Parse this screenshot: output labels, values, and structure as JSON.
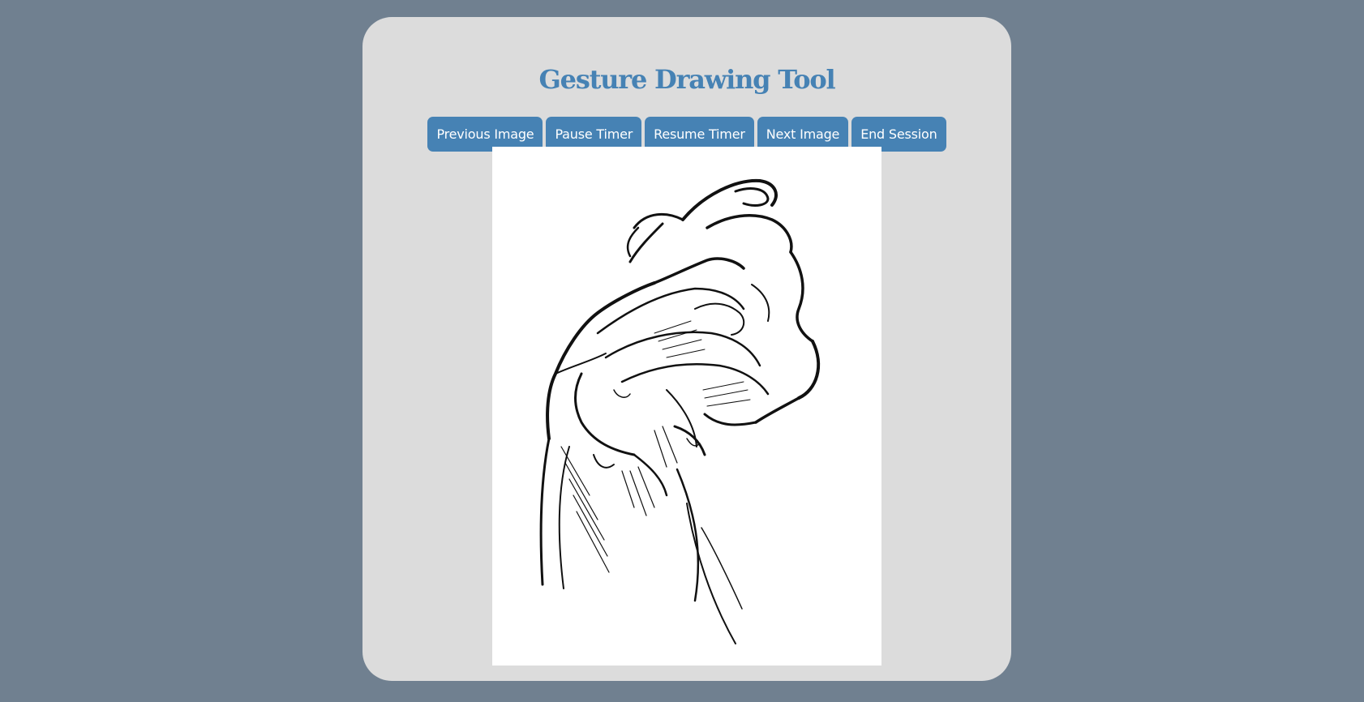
{
  "app": {
    "title": "Gesture Drawing Tool"
  },
  "toolbar": {
    "buttons": [
      {
        "label": "Previous Image"
      },
      {
        "label": "Pause Timer"
      },
      {
        "label": "Resume Timer"
      },
      {
        "label": "Next Image"
      },
      {
        "label": "End Session"
      }
    ]
  },
  "reference_image": {
    "subject": "hand-sketch",
    "background": "#ffffff",
    "ink": "#111111"
  },
  "colors": {
    "page_background": "#708090",
    "panel_background": "#dcdcdc",
    "accent": "#4682b4",
    "button_text": "#ffffff"
  }
}
